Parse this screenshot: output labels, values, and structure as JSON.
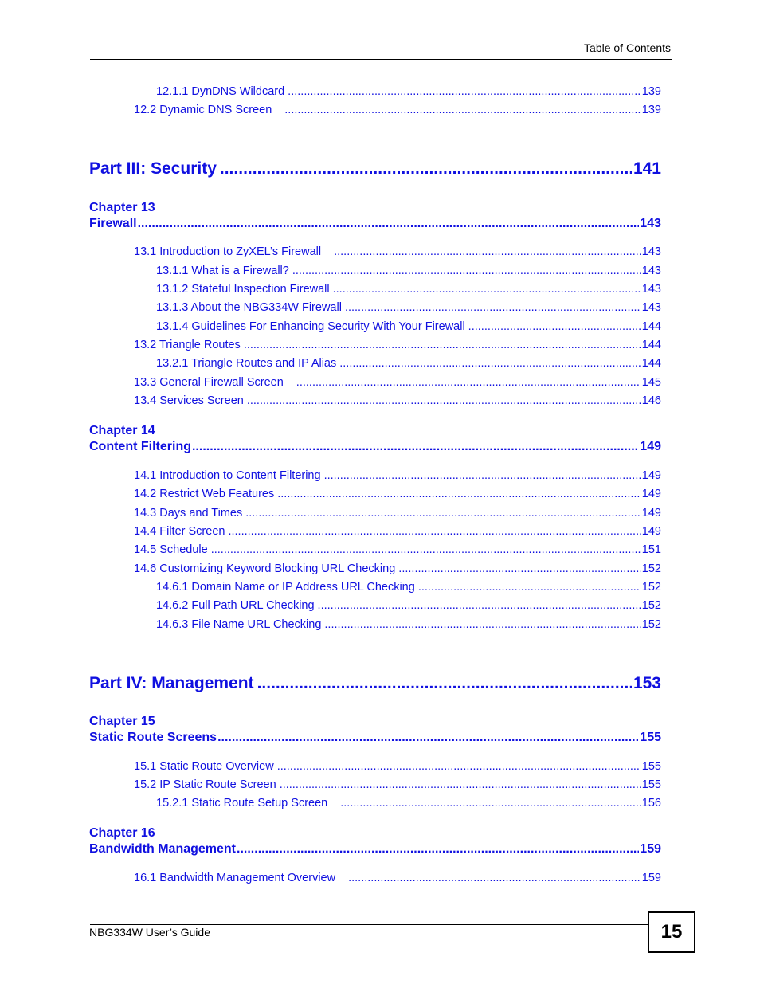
{
  "header": {
    "title": "Table of Contents"
  },
  "toc": {
    "pre": [
      {
        "title": "12.1.1 DynDNS Wildcard",
        "page": "139"
      },
      {
        "title": "12.2 Dynamic DNS Screen",
        "page": "139"
      }
    ],
    "part3": {
      "title": "Part III: Security",
      "page": "141"
    },
    "ch13": {
      "label": "Chapter  13",
      "title": "Firewall",
      "page": "143",
      "sections": [
        {
          "title": "13.1 Introduction to ZyXEL’s Firewall",
          "page": "143"
        },
        {
          "title": "13.1.1 What is a Firewall?",
          "page": "143"
        },
        {
          "title": "13.1.2 Stateful Inspection Firewall",
          "page": "143"
        },
        {
          "title": "13.1.3 About the NBG334W Firewall",
          "page": "143"
        },
        {
          "title": "13.1.4 Guidelines For Enhancing Security With Your Firewall",
          "page": "144"
        },
        {
          "title": "13.2 Triangle Routes",
          "page": "144"
        },
        {
          "title": "13.2.1 Triangle Routes and IP Alias",
          "page": "144"
        },
        {
          "title": "13.3 General Firewall Screen",
          "page": "145"
        },
        {
          "title": "13.4  Services Screen",
          "page": "146"
        }
      ]
    },
    "ch14": {
      "label": "Chapter  14",
      "title": "Content Filtering",
      "page": "149",
      "sections": [
        {
          "title": "14.1 Introduction to Content Filtering",
          "page": "149"
        },
        {
          "title": "14.2 Restrict Web Features",
          "page": "149"
        },
        {
          "title": "14.3 Days and Times",
          "page": "149"
        },
        {
          "title": "14.4 Filter Screen",
          "page": "149"
        },
        {
          "title": "14.5 Schedule",
          "page": "151"
        },
        {
          "title": "14.6 Customizing Keyword Blocking URL Checking",
          "page": "152"
        },
        {
          "title": "14.6.1 Domain Name or IP Address URL Checking",
          "page": "152"
        },
        {
          "title": "14.6.2 Full Path URL Checking",
          "page": "152"
        },
        {
          "title": "14.6.3 File Name URL Checking",
          "page": "152"
        }
      ]
    },
    "part4": {
      "title": "Part IV: Management",
      "page": "153"
    },
    "ch15": {
      "label": "Chapter  15",
      "title": "Static Route Screens",
      "page": "155",
      "sections": [
        {
          "title": "15.1 Static Route Overview",
          "page": "155"
        },
        {
          "title": "15.2 IP Static Route Screen",
          "page": "155"
        },
        {
          "title": "15.2.1 Static Route Setup Screen",
          "page": "156"
        }
      ]
    },
    "ch16": {
      "label": "Chapter  16",
      "title": "Bandwidth Management",
      "page": "159",
      "sections": [
        {
          "title": "16.1 Bandwidth Management Overview",
          "page": "159"
        }
      ]
    }
  },
  "footer": {
    "guide": "NBG334W User’s Guide",
    "page_number": "15"
  },
  "colors": {
    "link": "#1010e0",
    "text": "#000000"
  }
}
